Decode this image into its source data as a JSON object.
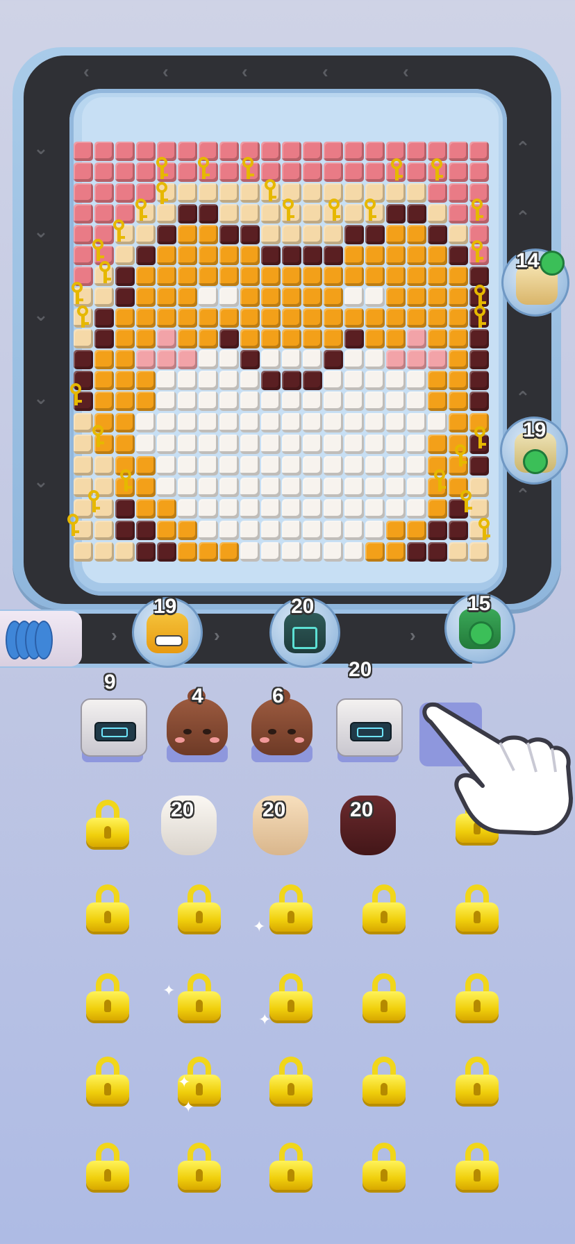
{
  "board": {
    "palette": {
      "pink": "#e97b86",
      "cream": "#f5d9a8",
      "brown": "#5a1f22",
      "orange": "#f3a019",
      "white": "#f7f3ee",
      "lightpink": "#f2a3a8"
    },
    "rows": [
      "PPPPPPPPPPPPPPPPPPPP",
      "PPPPPPPPPPPPPPPPPPPP",
      "PPPPCCCCCCCCCCCCCPPP",
      "PPPCCBBCCCCCCCCBBCPP",
      "PPCCBOOBBCCCCBBOOBCP",
      "PPCBOOOOOBBBBOOOOOBP",
      "PCBOOOOOOOOOOOOOOOOB",
      "CCBOOOWWOOOOOWWOOOOB",
      "CBOOOOOOOOOOOOOOOOOB",
      "CBOOLOOBOOOOOBOOLOOB",
      "BOOLLLWWBWWWBWWLLLOB",
      "BOOOWWWWWBBBWWWWWOOB",
      "BOOOWWWWWWWWWWWWWOOB",
      "COOWWWWWWWWWWWWWWWOO",
      "COOWWWWWWWWWWWWWWOOB",
      "CCOOWWWWWWWWWWWWWOOB",
      "CCOOWWWWWWWWWWWWWOOC",
      "CCBOOWWWWWWWWWWWWOBC",
      "CCBBOOWWWWWWWWWOOBBC",
      "CCCBBOOOWWWWWWOOBBCC"
    ]
  },
  "belt_figures": [
    {
      "name": "helmet-robot",
      "count": "19"
    },
    {
      "name": "teal-robot",
      "count": "20"
    },
    {
      "name": "green-ghost",
      "count": "15"
    },
    {
      "name": "right-figure-top",
      "count": "14"
    },
    {
      "name": "right-figure-mid",
      "count": "19"
    }
  ],
  "queue": [
    {
      "kind": "robot",
      "count": "9"
    },
    {
      "kind": "blob",
      "count": "4"
    },
    {
      "kind": "blob",
      "count": "6"
    },
    {
      "kind": "robot",
      "count": "20"
    }
  ],
  "beans": [
    {
      "color": "#f3efea",
      "count": "20"
    },
    {
      "color": "#f0d3ad",
      "count": "20"
    },
    {
      "color": "#5b2225",
      "count": "20"
    }
  ],
  "colors": {
    "lock": "#f1d61a",
    "belt": "#2f3035",
    "frame": "#9ec2e6"
  }
}
